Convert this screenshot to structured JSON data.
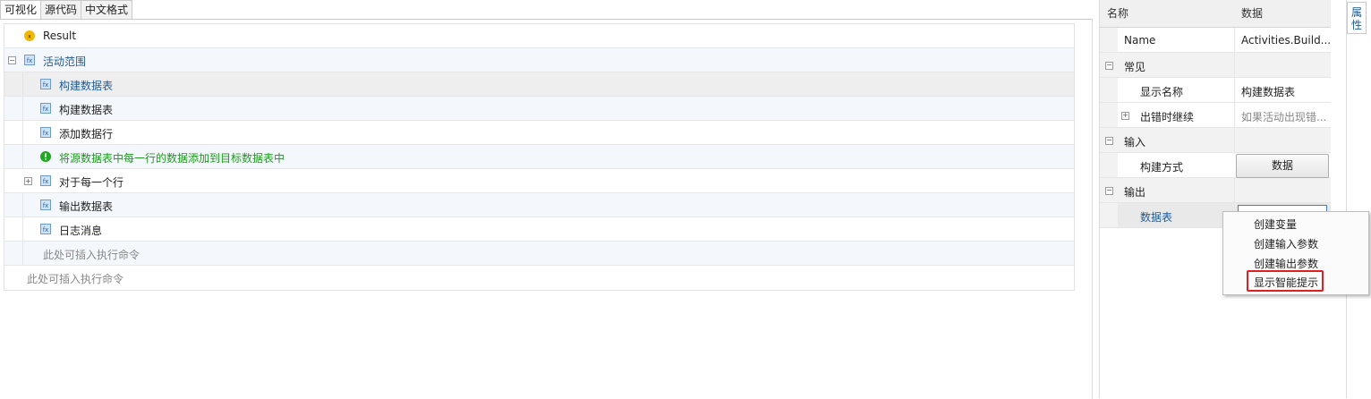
{
  "tabs": [
    "可视化",
    "源代码",
    "中文格式"
  ],
  "tree": {
    "result_label": "Result",
    "scope_label": "活动范围",
    "items": [
      "构建数据表",
      "构建数据表",
      "添加数据行",
      "将源数据表中每一行的数据添加到目标数据表中",
      "对于每一个行",
      "输出数据表",
      "日志消息"
    ],
    "insert_hint_inner": "此处可插入执行命令",
    "insert_hint_outer": "此处可插入执行命令"
  },
  "properties": {
    "header_name": "名称",
    "header_data": "数据",
    "name_key": "Name",
    "name_value": "Activities.Build...",
    "cat_common": "常见",
    "display_name_key": "显示名称",
    "display_name_value": "构建数据表",
    "continue_on_error_key": "出错时继续",
    "continue_on_error_value": "如果活动出现错...",
    "cat_input": "输入",
    "build_mode_key": "构建方式",
    "build_mode_button": "数据",
    "cat_output": "输出",
    "datatable_key": "数据表"
  },
  "side_tab": "属性",
  "context_menu": [
    "创建变量",
    "创建输入参数",
    "创建输出参数",
    "显示智能提示"
  ]
}
